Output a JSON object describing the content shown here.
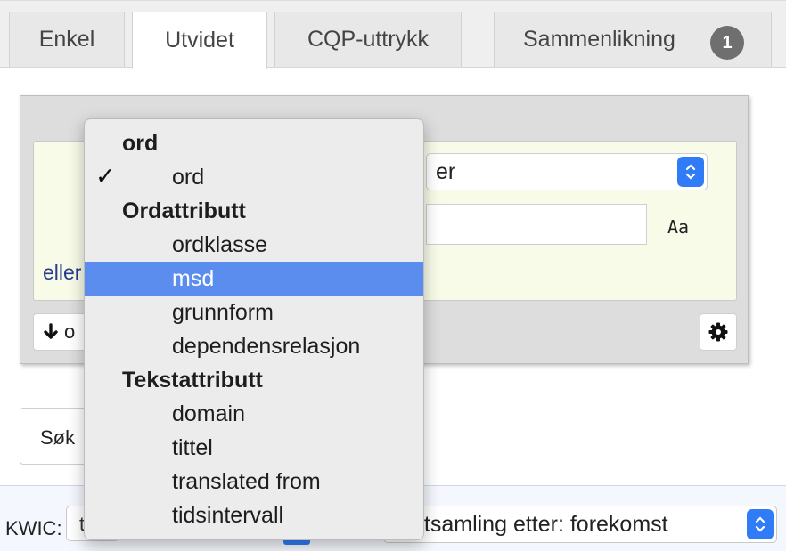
{
  "tabs": [
    {
      "label": "Enkel"
    },
    {
      "label": "Utvidet"
    },
    {
      "label": "CQP-uttrykk"
    },
    {
      "label": "Sammenlikning",
      "badge": "1"
    }
  ],
  "token": {
    "attribute_select_text": "er",
    "case_label": "Aa",
    "or_label": "eller",
    "add_or_text": "o"
  },
  "search": {
    "label": "Søk"
  },
  "bottom": {
    "kwic_label": "KWIC:",
    "kwic_value": "t",
    "sort_text": "ekstsamling etter: forekomst"
  },
  "dropdown": {
    "items": [
      {
        "type": "group",
        "label": "ord"
      },
      {
        "type": "option",
        "label": "ord",
        "checked": true
      },
      {
        "type": "group",
        "label": "Ordattributt"
      },
      {
        "type": "option",
        "label": "ordklasse"
      },
      {
        "type": "option",
        "label": "msd",
        "highlighted": true
      },
      {
        "type": "option",
        "label": "grunnform"
      },
      {
        "type": "option",
        "label": "dependensrelasjon"
      },
      {
        "type": "group",
        "label": "Tekstattributt"
      },
      {
        "type": "option",
        "label": "domain"
      },
      {
        "type": "option",
        "label": "tittel"
      },
      {
        "type": "option",
        "label": "translated from"
      },
      {
        "type": "option",
        "label": "tidsintervall"
      }
    ],
    "check_glyph": "✓"
  },
  "colors": {
    "accent": "#2f7cf6",
    "highlight": "#5b8def",
    "or_text": "#2a3a8c"
  }
}
